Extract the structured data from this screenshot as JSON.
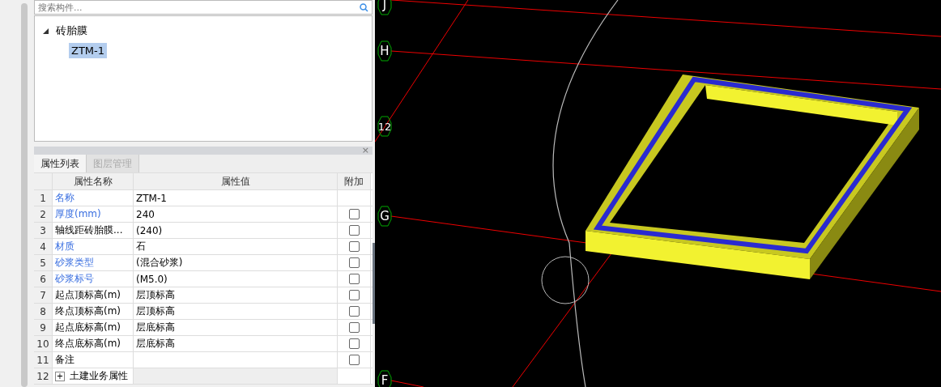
{
  "search": {
    "placeholder": "搜索构件..."
  },
  "tree": [
    {
      "label": "砖胎膜",
      "expanded": true,
      "selected": false,
      "children": [
        {
          "label": "ZTM-1",
          "selected": true
        }
      ]
    }
  ],
  "properties_panel": {
    "close": "×",
    "tabs": [
      {
        "label": "属性列表",
        "selected": true
      },
      {
        "label": "图层管理",
        "selected": false
      }
    ],
    "columns": [
      "属性名称",
      "属性值",
      "附加"
    ],
    "rows": [
      {
        "kind": "attr",
        "index": "1",
        "name": "名称",
        "public": true,
        "value": "ZTM-1"
      },
      {
        "kind": "attr",
        "index": "2",
        "name": "厚度(mm)",
        "public": true,
        "value": "240",
        "checked": false
      },
      {
        "kind": "attr",
        "index": "3",
        "name": "轴线距砖胎膜...",
        "public": false,
        "value": "(240)",
        "checked": false
      },
      {
        "kind": "attr",
        "index": "4",
        "name": "材质",
        "public": true,
        "value": "石",
        "checked": false
      },
      {
        "kind": "attr",
        "index": "5",
        "name": "砂浆类型",
        "public": true,
        "value": "(混合砂浆)",
        "checked": false
      },
      {
        "kind": "attr",
        "index": "6",
        "name": "砂浆标号",
        "public": true,
        "value": "(M5.0)",
        "checked": false
      },
      {
        "kind": "attr",
        "index": "7",
        "name": "起点顶标高(m)",
        "public": false,
        "value": "层顶标高",
        "checked": false
      },
      {
        "kind": "attr",
        "index": "8",
        "name": "终点顶标高(m)",
        "public": false,
        "value": "层顶标高",
        "checked": false
      },
      {
        "kind": "attr",
        "index": "9",
        "name": "起点底标高(m)",
        "public": false,
        "value": "层底标高",
        "checked": false
      },
      {
        "kind": "attr",
        "index": "10",
        "name": "终点底标高(m)",
        "public": false,
        "value": "层底标高",
        "checked": false
      },
      {
        "kind": "attr",
        "index": "11",
        "name": "备注",
        "public": false,
        "value": "",
        "checked": false
      },
      {
        "kind": "group",
        "index": "12",
        "name": "土建业务属性",
        "expander": "+",
        "expanded": false
      }
    ]
  },
  "viewport": {
    "axis_labels": [
      {
        "label": "J"
      },
      {
        "label": "H"
      },
      {
        "label": "12"
      },
      {
        "label": "G"
      },
      {
        "label": "F"
      }
    ]
  }
}
